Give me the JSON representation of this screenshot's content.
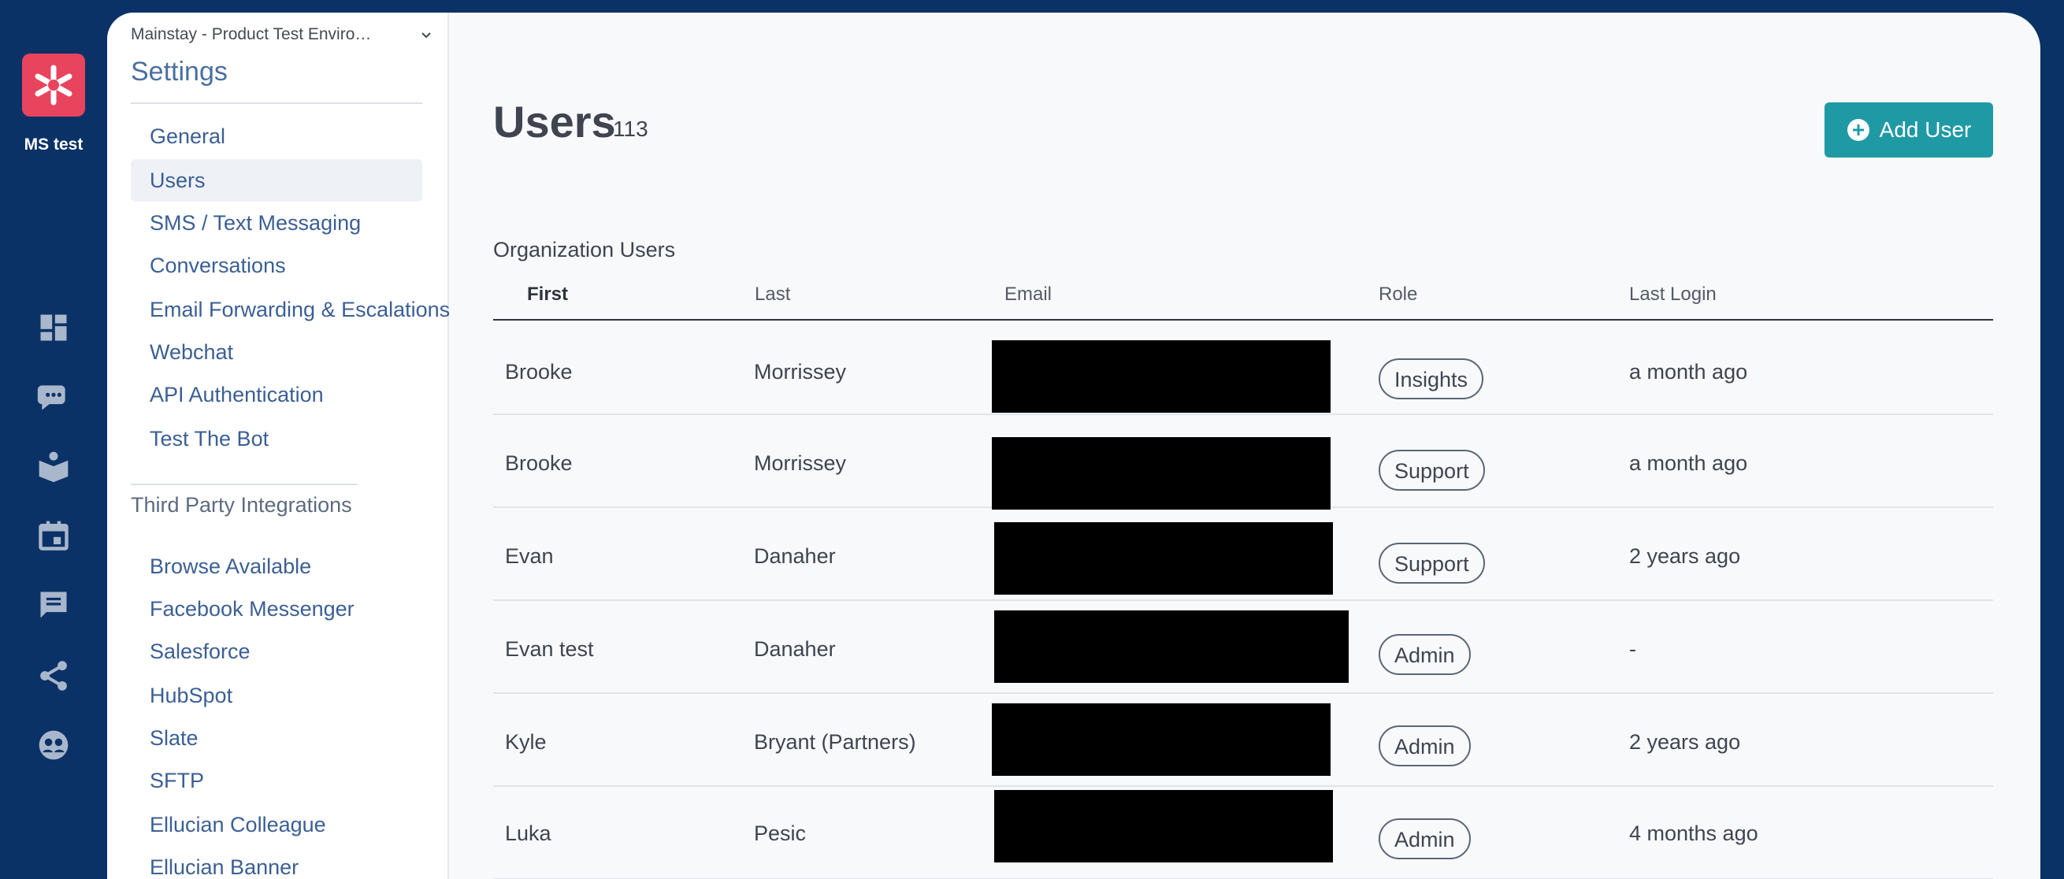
{
  "org": {
    "name": "MS test"
  },
  "colors": {
    "rail": "#0b3266",
    "logo": "#e8445e",
    "accent": "#1f9aa5",
    "nav_text": "#3b5f94"
  },
  "rail_icons": [
    "dashboard-icon",
    "chat-bubble-icon",
    "knowledge-book-icon",
    "calendar-icon",
    "message-icon",
    "share-network-icon",
    "contacts-icon"
  ],
  "settings": {
    "environment": "Mainstay - Product Test Enviro…",
    "title": "Settings",
    "items": [
      {
        "label": "General"
      },
      {
        "label": "Users",
        "active": true
      },
      {
        "label": "SMS / Text Messaging"
      },
      {
        "label": "Conversations"
      },
      {
        "label": "Email Forwarding & Escalations"
      },
      {
        "label": "Webchat"
      },
      {
        "label": "API Authentication"
      },
      {
        "label": "Test The Bot"
      }
    ],
    "integrations_title": "Third Party Integrations",
    "integrations": [
      {
        "label": "Browse Available"
      },
      {
        "label": "Facebook Messenger"
      },
      {
        "label": "Salesforce"
      },
      {
        "label": "HubSpot"
      },
      {
        "label": "Slate"
      },
      {
        "label": "SFTP"
      },
      {
        "label": "Ellucian Colleague"
      },
      {
        "label": "Ellucian Banner"
      }
    ]
  },
  "page": {
    "title": "Users",
    "count": "113",
    "add_button": "Add User",
    "section_title": "Organization Users"
  },
  "table": {
    "columns": [
      "First",
      "Last",
      "Email",
      "Role",
      "Last Login"
    ],
    "rows": [
      {
        "first": "Brooke",
        "last": "Morrissey",
        "role": "Insights",
        "last_login": "a month ago"
      },
      {
        "first": "Brooke",
        "last": "Morrissey",
        "role": "Support",
        "last_login": "a month ago"
      },
      {
        "first": "Evan",
        "last": "Danaher",
        "role": "Support",
        "last_login": "2 years ago"
      },
      {
        "first": "Evan test",
        "last": "Danaher",
        "role": "Admin",
        "last_login": "-"
      },
      {
        "first": "Kyle",
        "last": "Bryant (Partners)",
        "role": "Admin",
        "last_login": "2 years ago"
      },
      {
        "first": "Luka",
        "last": "Pesic",
        "role": "Admin",
        "last_login": "4 months ago"
      }
    ]
  }
}
